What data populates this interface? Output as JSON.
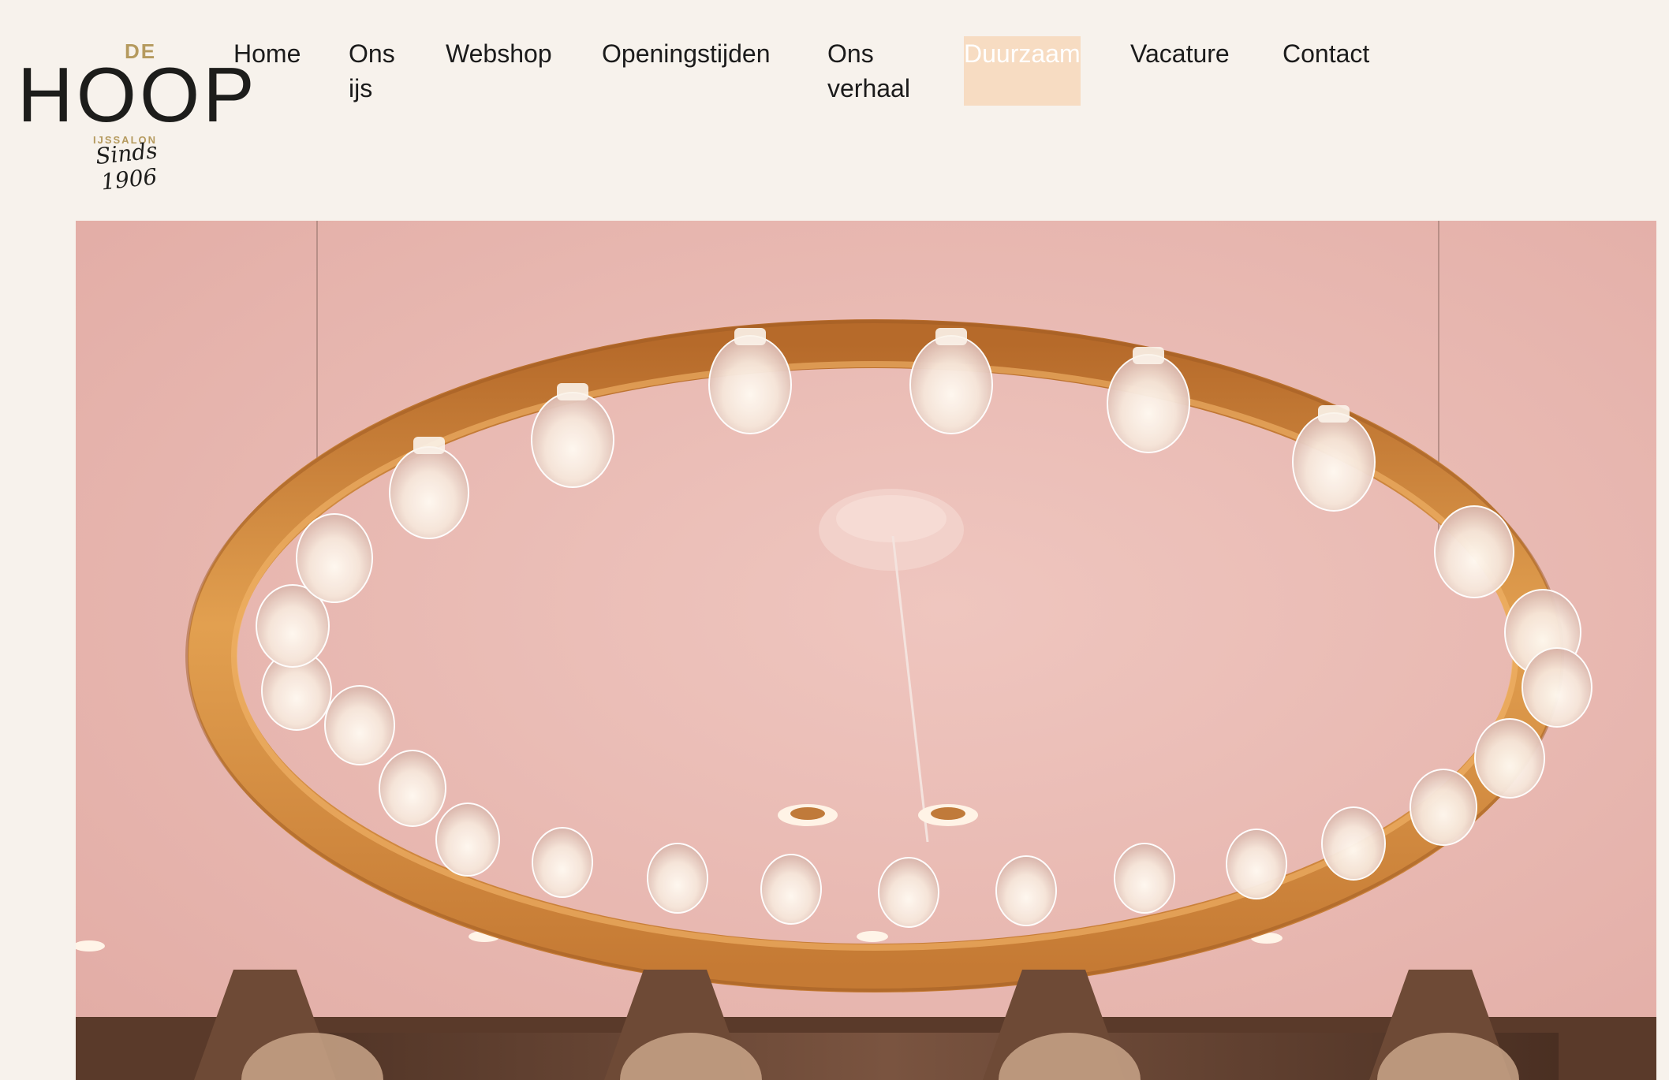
{
  "logo": {
    "de": "DE",
    "name": "HOOP",
    "tagline": "IJSSALON",
    "since": "Sinds 1906"
  },
  "nav": {
    "items": [
      {
        "label": "Home"
      },
      {
        "label": "Ons ijs"
      },
      {
        "label": "Webshop"
      },
      {
        "label": "Openingstijden"
      },
      {
        "label": "Ons verhaal"
      },
      {
        "label": "Duurzaam",
        "active": true
      },
      {
        "label": "Vacature"
      },
      {
        "label": "Contact"
      }
    ]
  },
  "colors": {
    "page_bg": "#f7f2ec",
    "active_highlight": "#f7dcc2",
    "ceiling_pink": "#e9b8b0",
    "ring_gold": "#d28a3c",
    "logo_gold": "#b59a5e"
  }
}
